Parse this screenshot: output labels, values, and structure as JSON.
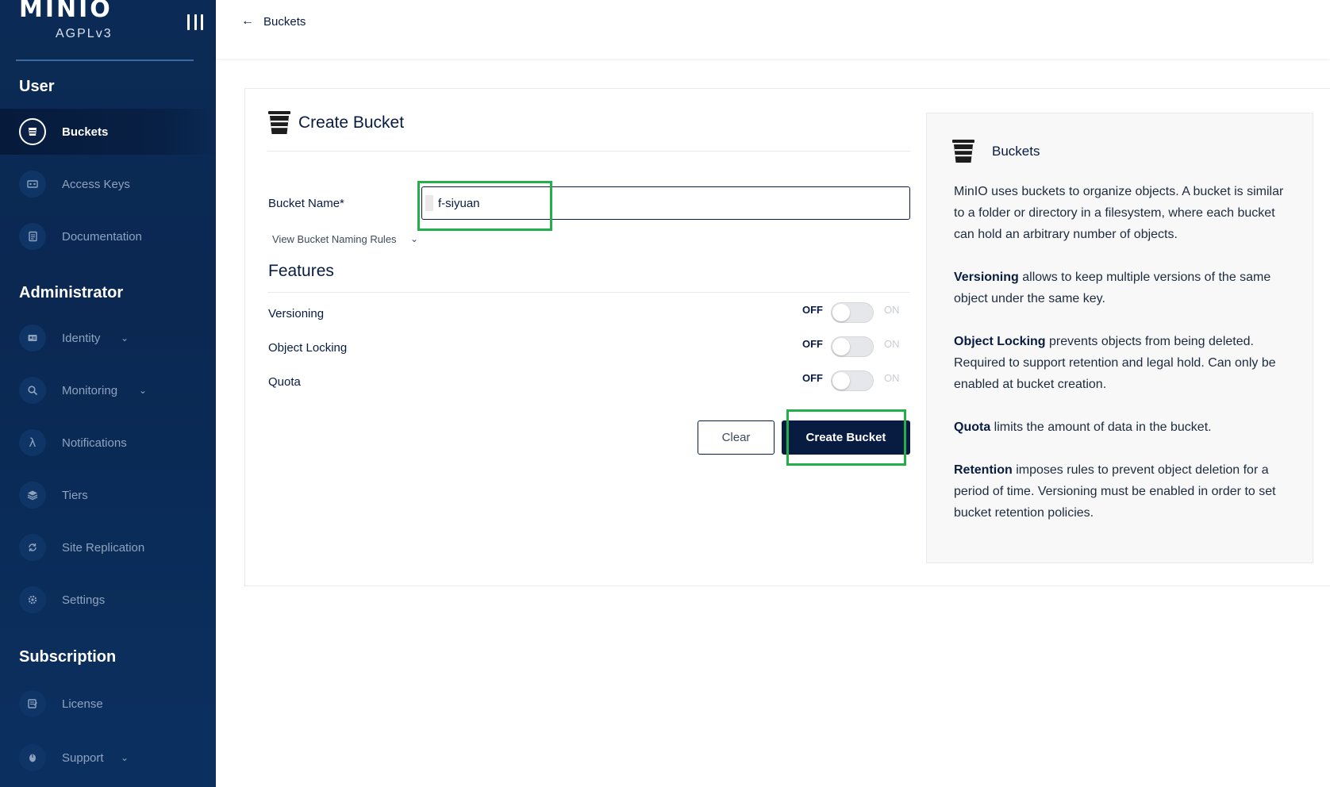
{
  "sidebar": {
    "logo": {
      "word": "MINIO",
      "edition": "AGPLv3"
    },
    "sections": {
      "user": "User",
      "administrator": "Administrator",
      "subscription": "Subscription"
    },
    "items": {
      "buckets": "Buckets",
      "access_keys": "Access Keys",
      "documentation": "Documentation",
      "identity": "Identity",
      "monitoring": "Monitoring",
      "notifications": "Notifications",
      "tiers": "Tiers",
      "site_replication": "Site Replication",
      "settings": "Settings",
      "license": "License",
      "support": "Support"
    },
    "chevron": "⌄",
    "notifications_glyph": "λ"
  },
  "topbar": {
    "back_arrow": "←",
    "back_label": "Buckets"
  },
  "form": {
    "title": "Create Bucket",
    "bucket_name_label": "Bucket Name*",
    "bucket_name_value": "f-siyuan",
    "naming_rules_link": "View Bucket Naming Rules",
    "naming_rules_chevron": "⌄",
    "features_title": "Features",
    "features": {
      "versioning": {
        "label": "Versioning",
        "off": "OFF",
        "on": "ON",
        "enabled": false
      },
      "object_locking": {
        "label": "Object Locking",
        "off": "OFF",
        "on": "ON",
        "enabled": false
      },
      "quota": {
        "label": "Quota",
        "off": "OFF",
        "on": "ON",
        "enabled": false
      }
    },
    "clear_button": "Clear",
    "create_button": "Create Bucket"
  },
  "help": {
    "title": "Buckets",
    "intro": "MinIO uses buckets to organize objects. A bucket is similar to a folder or directory in a filesystem, where each bucket can hold an arbitrary number of objects.",
    "versioning_term": "Versioning",
    "versioning_text": " allows to keep multiple versions of the same object under the same key.",
    "locking_term": "Object Locking",
    "locking_text": " prevents objects from being deleted. Required to support retention and legal hold. Can only be enabled at bucket creation.",
    "quota_term": "Quota",
    "quota_text": " limits the amount of data in the bucket.",
    "retention_term": "Retention",
    "retention_text": " imposes rules to prevent object deletion for a period of time. Versioning must be enabled in order to set bucket retention policies."
  },
  "colors": {
    "sidebar_bg": "#0b2a55",
    "primary": "#081c42",
    "highlight": "#23b04a",
    "muted_text": "#8fa3bf"
  }
}
